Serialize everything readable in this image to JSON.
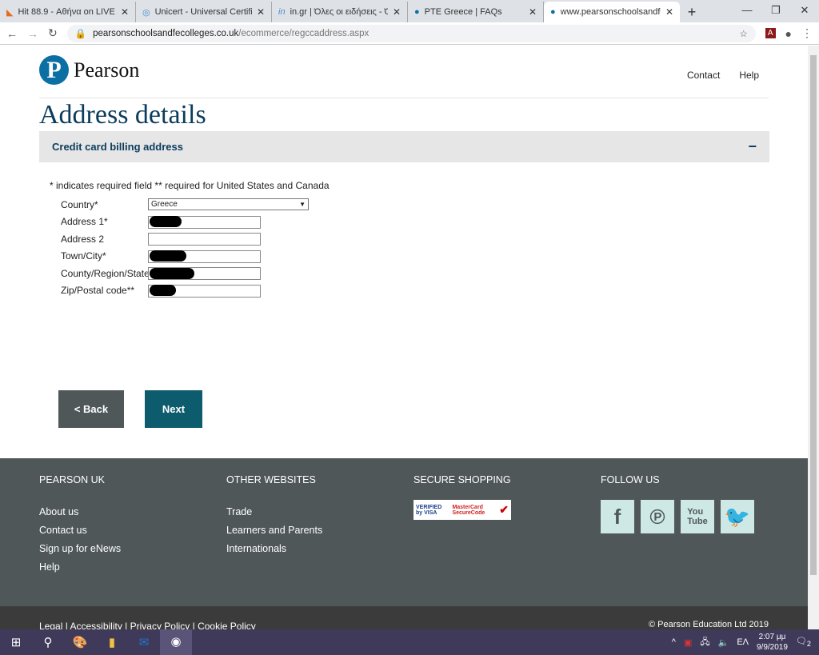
{
  "browser": {
    "tabs": [
      {
        "title": "Hit 88.9 - Αθήνα on LIVE",
        "icon": "radio-icon"
      },
      {
        "title": "Unicert - Universal Certificate",
        "icon": "unicert-icon"
      },
      {
        "title": "in.gr | Όλες οι ειδήσεις - Όλη",
        "icon": "in-gr-icon"
      },
      {
        "title": "PTE Greece | FAQs",
        "icon": "pearson-icon"
      },
      {
        "title": "www.pearsonschoolsandfecolleges",
        "icon": "pearson-icon",
        "active": true
      }
    ],
    "url_host": "pearsonschoolsandfecolleges.co.uk",
    "url_path": "/ecommerce/regccaddress.aspx"
  },
  "header": {
    "logo_letter": "P",
    "brand": "Pearson",
    "nav": [
      "Contact",
      "Help"
    ]
  },
  "page_title": "Address details",
  "panel": {
    "title": "Credit card billing address",
    "toggle": "−"
  },
  "required_note": "* indicates required field ** required for United States and Canada",
  "form": {
    "country_label": "Country*",
    "country_value": "Greece",
    "fields": [
      {
        "label": "Address 1*",
        "redacted": true
      },
      {
        "label": "Address 2",
        "redacted": false
      },
      {
        "label": "Town/City*",
        "redacted": true
      },
      {
        "label": "County/Region/State",
        "redacted": true
      },
      {
        "label": "Zip/Postal code**",
        "redacted": true
      }
    ]
  },
  "buttons": {
    "back": "< Back",
    "next": "Next"
  },
  "footer": {
    "pearson_uk": {
      "title": "PEARSON UK",
      "links": [
        "About us",
        "Contact us",
        "Sign up for eNews",
        "Help"
      ]
    },
    "other": {
      "title": "OTHER WEBSITES",
      "links": [
        "Trade",
        "Learners and Parents",
        "Internationals"
      ]
    },
    "secure": {
      "title": "SECURE SHOPPING",
      "badges": [
        "VERIFIED by VISA",
        "MasterCard SecureCode"
      ]
    },
    "follow": {
      "title": "FOLLOW US",
      "icons": [
        "facebook-icon",
        "pinterest-icon",
        "youtube-icon",
        "twitter-icon"
      ]
    }
  },
  "bottom": {
    "links": "Legal  | Accessibility | Privacy Policy | Cookie Policy",
    "copyright": "© Pearson Education Ltd  2019"
  },
  "taskbar": {
    "lang": "ΕΛ",
    "time": "2:07 μμ",
    "date": "9/9/2019",
    "notifications": "2"
  },
  "colors": {
    "brand_blue": "#0b6fa4",
    "title": "#0b3c5d",
    "next": "#0d5c6e",
    "footer": "#505759"
  }
}
